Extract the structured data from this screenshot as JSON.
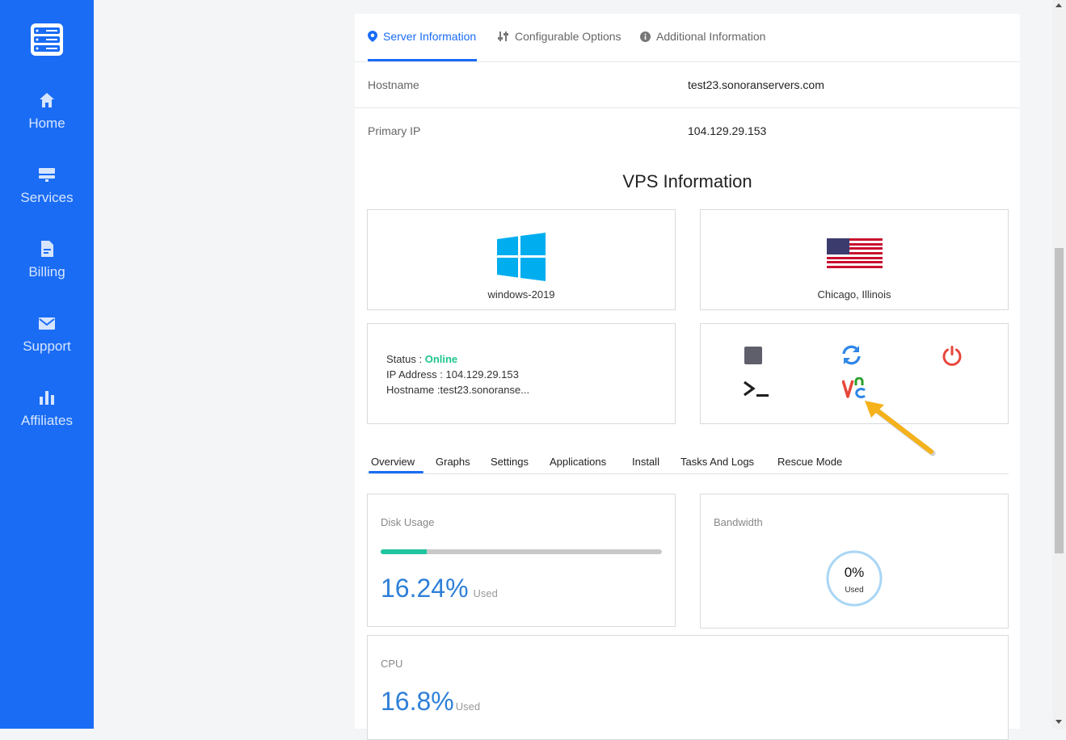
{
  "sidebar": {
    "items": [
      {
        "label": "Home",
        "icon": "home-icon"
      },
      {
        "label": "Services",
        "icon": "server-icon"
      },
      {
        "label": "Billing",
        "icon": "document-icon"
      },
      {
        "label": "Support",
        "icon": "envelope-icon"
      },
      {
        "label": "Affiliates",
        "icon": "bar-chart-icon"
      }
    ]
  },
  "top_tabs": [
    {
      "label": "Server Information",
      "icon": "location-pin-icon",
      "active": true
    },
    {
      "label": "Configurable Options",
      "icon": "sliders-icon",
      "active": false
    },
    {
      "label": "Additional Information",
      "icon": "info-icon",
      "active": false
    }
  ],
  "server_info": [
    {
      "key": "Hostname",
      "value": "test23.sonoranservers.com"
    },
    {
      "key": "Primary IP",
      "value": "104.129.29.153"
    }
  ],
  "vps": {
    "title": "VPS Information",
    "os_label": "windows-2019",
    "location_label": "Chicago, Illinois",
    "status_key": "Status :",
    "status_value": "Online",
    "ip_key": "IP Address :",
    "ip_value": "104.129.29.153",
    "hostname_key": "Hostname :",
    "hostname_value": "test23.sonoranse..."
  },
  "controls": [
    "stop-icon",
    "reboot-icon",
    "power-icon",
    "console-icon",
    "vnc-icon"
  ],
  "sub_tabs": [
    {
      "label": "Overview",
      "active": true
    },
    {
      "label": "Graphs"
    },
    {
      "label": "Settings"
    },
    {
      "label": "Applications"
    },
    {
      "label": "Install"
    },
    {
      "label": "Tasks And Logs"
    },
    {
      "label": "Rescue Mode"
    }
  ],
  "disk": {
    "title": "Disk Usage",
    "value": "16.24%",
    "used_label": "Used",
    "fraction": 0.1624
  },
  "bandwidth": {
    "title": "Bandwidth",
    "value": "0%",
    "used_label": "Used"
  },
  "cpu": {
    "title": "CPU",
    "value": "16.8%",
    "used_label": "Used"
  },
  "colors": {
    "sidebar": "#1a6cf5",
    "accent": "#1a6cf5",
    "online": "#1fc58e",
    "metric": "#2e7fd8",
    "arrow": "#f5b21a"
  }
}
